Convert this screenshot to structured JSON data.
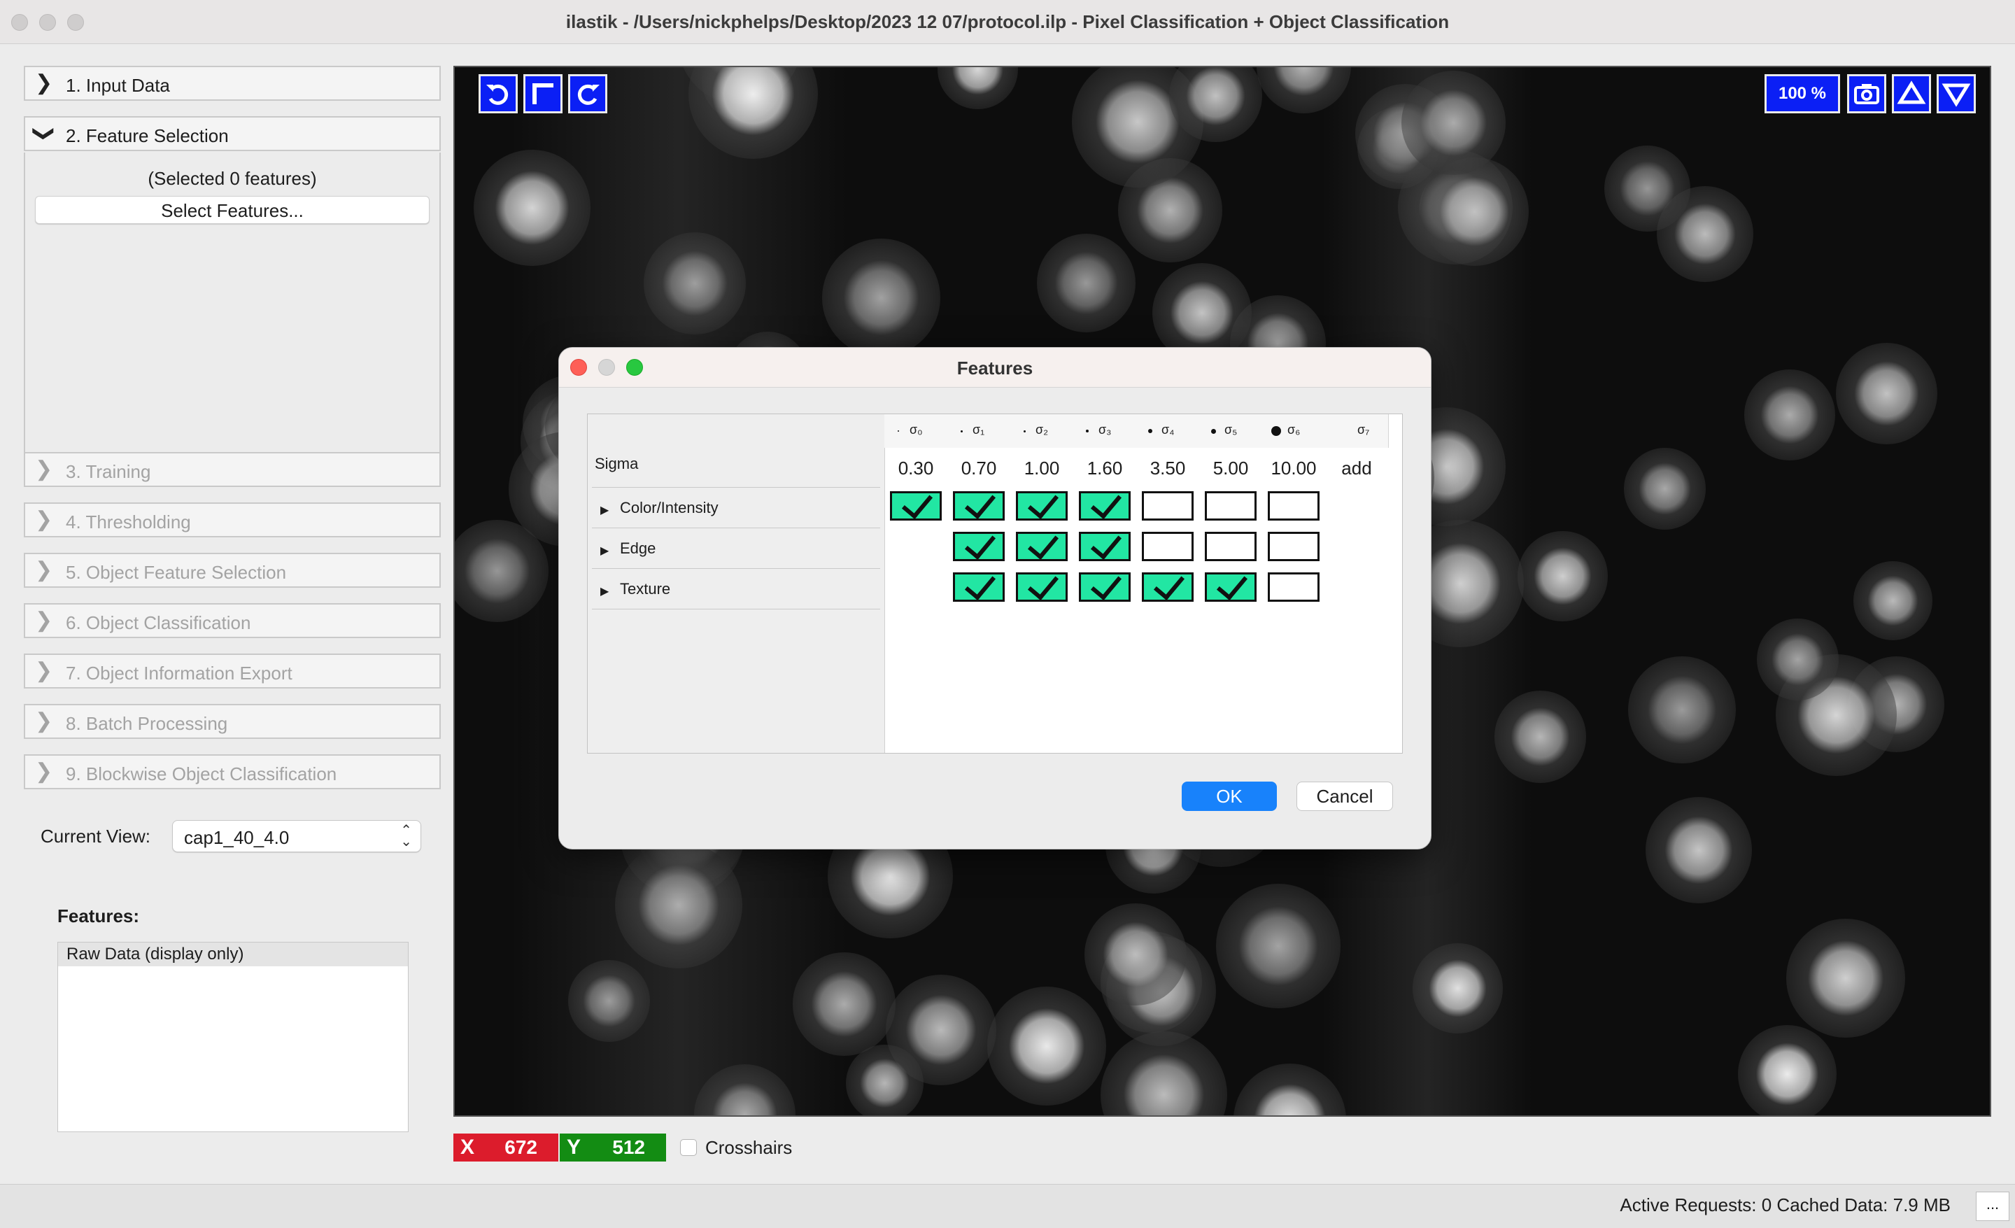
{
  "window": {
    "title": "ilastik - /Users/nickphelps/Desktop/2023 12 07/protocol.ilp - Pixel Classification + Object Classification"
  },
  "applets": [
    {
      "label": "1. Input Data",
      "expanded": false,
      "enabled": true
    },
    {
      "label": "2. Feature Selection",
      "expanded": true,
      "enabled": true
    },
    {
      "label": "3. Training",
      "expanded": false,
      "enabled": false
    },
    {
      "label": "4. Thresholding",
      "expanded": false,
      "enabled": false
    },
    {
      "label": "5. Object Feature Selection",
      "expanded": false,
      "enabled": false
    },
    {
      "label": "6. Object Classification",
      "expanded": false,
      "enabled": false
    },
    {
      "label": "7. Object Information Export",
      "expanded": false,
      "enabled": false
    },
    {
      "label": "8. Batch Processing",
      "expanded": false,
      "enabled": false
    },
    {
      "label": "9. Blockwise Object Classification",
      "expanded": false,
      "enabled": false
    }
  ],
  "feature_selection": {
    "selected_count_text": "(Selected 0 features)",
    "select_button_label": "Select Features..."
  },
  "current_view": {
    "label": "Current View:",
    "value": "cap1_40_4.0"
  },
  "features_panel": {
    "heading": "Features:",
    "items": [
      "Raw Data (display only)"
    ]
  },
  "viewer": {
    "toolbar": {
      "zoom": "100 %"
    },
    "position": {
      "x_label": "X",
      "x": "672",
      "y_label": "Y",
      "y": "512"
    },
    "crosshairs": {
      "label": "Crosshairs",
      "checked": false
    }
  },
  "status": {
    "text": "Active Requests: 0  Cached Data: 7.9 MB",
    "more_button": "..."
  },
  "dialog": {
    "title": "Features",
    "sigma_row_label": "Sigma",
    "columns": [
      {
        "symbol": "σ₀",
        "value": "0.30"
      },
      {
        "symbol": "σ₁",
        "value": "0.70"
      },
      {
        "symbol": "σ₂",
        "value": "1.00"
      },
      {
        "symbol": "σ₃",
        "value": "1.60"
      },
      {
        "symbol": "σ₄",
        "value": "3.50"
      },
      {
        "symbol": "σ₅",
        "value": "5.00"
      },
      {
        "symbol": "σ₆",
        "value": "10.00"
      },
      {
        "symbol": "σ₇",
        "value": "add"
      }
    ],
    "groups": [
      {
        "name": "Color/Intensity",
        "checks": [
          true,
          true,
          true,
          true,
          false,
          false,
          false
        ]
      },
      {
        "name": "Edge",
        "checks": [
          null,
          true,
          true,
          true,
          false,
          false,
          false
        ]
      },
      {
        "name": "Texture",
        "checks": [
          null,
          true,
          true,
          true,
          true,
          true,
          false
        ]
      }
    ],
    "ok_label": "OK",
    "cancel_label": "Cancel"
  },
  "colors": {
    "checked_fill": "#22e6a3",
    "toolbar_blue": "#0b1ff5",
    "x_badge": "#dc1c2c",
    "y_badge": "#138c13",
    "ok_button": "#1882fb"
  }
}
